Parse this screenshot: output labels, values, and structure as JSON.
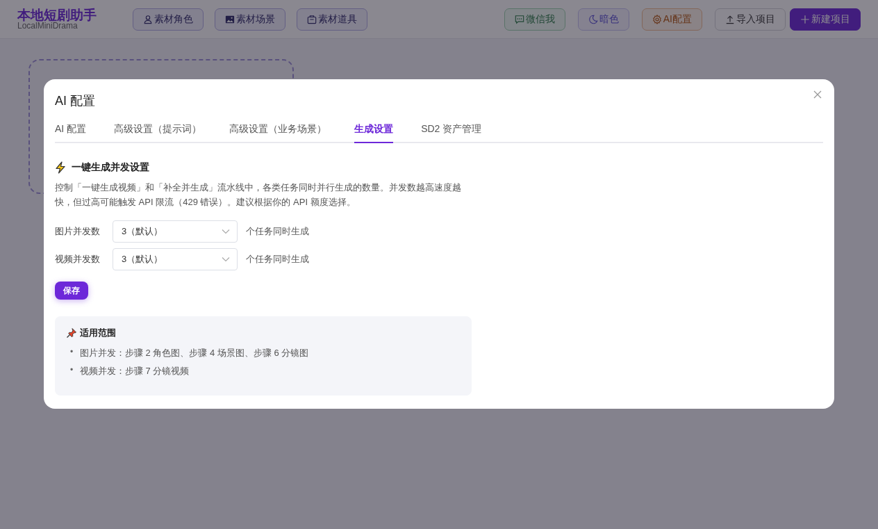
{
  "app": {
    "title": "本地短剧助手",
    "subtitle": "LocalMiniDrama"
  },
  "nav_left": [
    {
      "label": "素材角色"
    },
    {
      "label": "素材场景"
    },
    {
      "label": "素材道具"
    }
  ],
  "nav_right": [
    {
      "label": "微信我"
    },
    {
      "label": "暗色"
    },
    {
      "label": "AI配置"
    },
    {
      "label": "导入项目"
    },
    {
      "label": "新建项目"
    }
  ],
  "modal": {
    "title": "AI 配置",
    "tabs": [
      {
        "label": "AI 配置",
        "selected": false
      },
      {
        "label": "高级设置（提示词）",
        "selected": false
      },
      {
        "label": "高级设置（业务场景）",
        "selected": false
      },
      {
        "label": "生成设置",
        "selected": true
      },
      {
        "label": "SD2 资产管理",
        "selected": false
      }
    ],
    "section": {
      "title": "一键生成并发设置",
      "description": "控制「一键生成视频」和「补全并生成」流水线中，各类任务同时并行生成的数量。并发数越高速度越快，但过高可能触发 API 限流（429 错误）。建议根据你的 API 额度选择。"
    },
    "fields": [
      {
        "label": "图片并发数",
        "value": "3（默认）",
        "suffix": "个任务同时生成"
      },
      {
        "label": "视频并发数",
        "value": "3（默认）",
        "suffix": "个任务同时生成"
      }
    ],
    "save_button": "保存",
    "scope": {
      "title": "适用范围",
      "items": [
        {
          "bullet": "•",
          "text": "图片并发：步骤 2 角色图、步骤 4 场景图、步骤 6 分镜图"
        },
        {
          "bullet": "•",
          "text": "视频并发：步骤 7 分镜视频"
        }
      ]
    }
  }
}
